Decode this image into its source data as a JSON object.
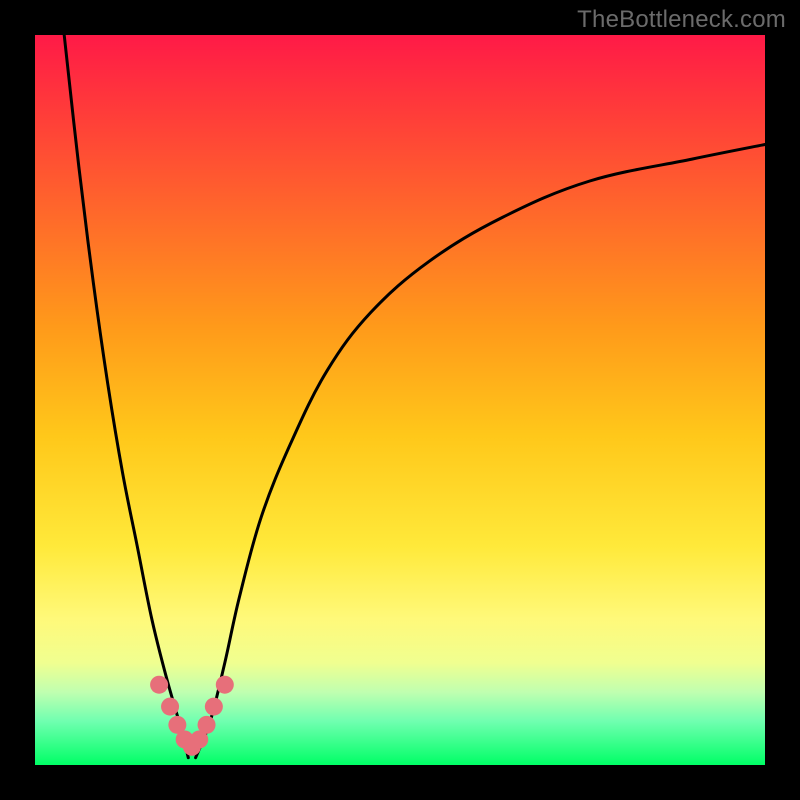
{
  "watermark": "TheBottleneck.com",
  "chart_data": {
    "type": "line",
    "title": "",
    "xlabel": "",
    "ylabel": "",
    "xlim": [
      0,
      100
    ],
    "ylim": [
      0,
      100
    ],
    "gradient_bands": [
      {
        "label": "red",
        "approx_y_range": [
          60,
          100
        ]
      },
      {
        "label": "orange",
        "approx_y_range": [
          35,
          60
        ]
      },
      {
        "label": "yellow",
        "approx_y_range": [
          10,
          35
        ]
      },
      {
        "label": "green",
        "approx_y_range": [
          0,
          10
        ]
      }
    ],
    "series": [
      {
        "name": "bottleneck-curve-left",
        "x": [
          4,
          6,
          8,
          10,
          12,
          14,
          16,
          18,
          20,
          21
        ],
        "y": [
          100,
          82,
          66,
          52,
          40,
          30,
          20,
          12,
          5,
          1
        ]
      },
      {
        "name": "bottleneck-curve-right",
        "x": [
          22,
          24,
          26,
          28,
          31,
          35,
          40,
          46,
          54,
          64,
          76,
          90,
          100
        ],
        "y": [
          1,
          6,
          14,
          23,
          34,
          44,
          54,
          62,
          69,
          75,
          80,
          83,
          85
        ]
      },
      {
        "name": "curve-min-markers",
        "x": [
          17,
          18.5,
          19.5,
          20.5,
          21.5,
          22.5,
          23.5,
          24.5,
          26
        ],
        "y": [
          11,
          8,
          5.5,
          3.5,
          2.5,
          3.5,
          5.5,
          8,
          11
        ]
      }
    ],
    "marker_color": "#e76f7a",
    "curve_color": "#000000",
    "notes": "Axes are unlabeled in the source image; x/y values are estimated proportionally from pixel positions on a 0–100 normalized range."
  }
}
